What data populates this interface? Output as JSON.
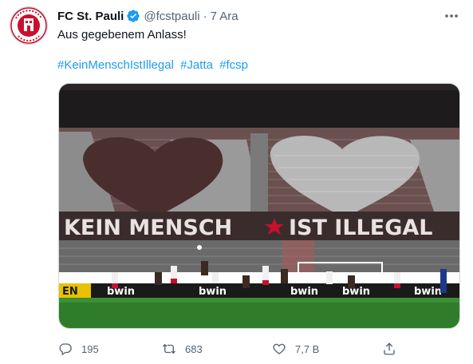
{
  "tweet": {
    "author_name": "FC St. Pauli",
    "handle": "@fcstpauli",
    "separator": "·",
    "time": "7 Ara",
    "text": "Aus gegebenem Anlass!",
    "hashtags": [
      "#KeinMenschIstIllegal",
      "#Jatta",
      "#fcsp"
    ]
  },
  "avatar": {
    "ring_top": "FC ST. PAULI",
    "year": "1910",
    "color": "#c8102e"
  },
  "media": {
    "banner_left": "KEIN MENSCH",
    "banner_right": "IST ILLEGAL",
    "ads": [
      "bwin",
      "bwin",
      "bwin",
      "bwin",
      "bwin"
    ],
    "ad_left": "EN",
    "pitch_color": "#2f7d2a",
    "seat_color": "#5c3a3a"
  },
  "actions": {
    "replies": "195",
    "retweets": "683",
    "likes": "7,7 B"
  },
  "colors": {
    "accent": "#1d9bf0",
    "muted": "#536471",
    "verified": "#1d9bf0"
  }
}
